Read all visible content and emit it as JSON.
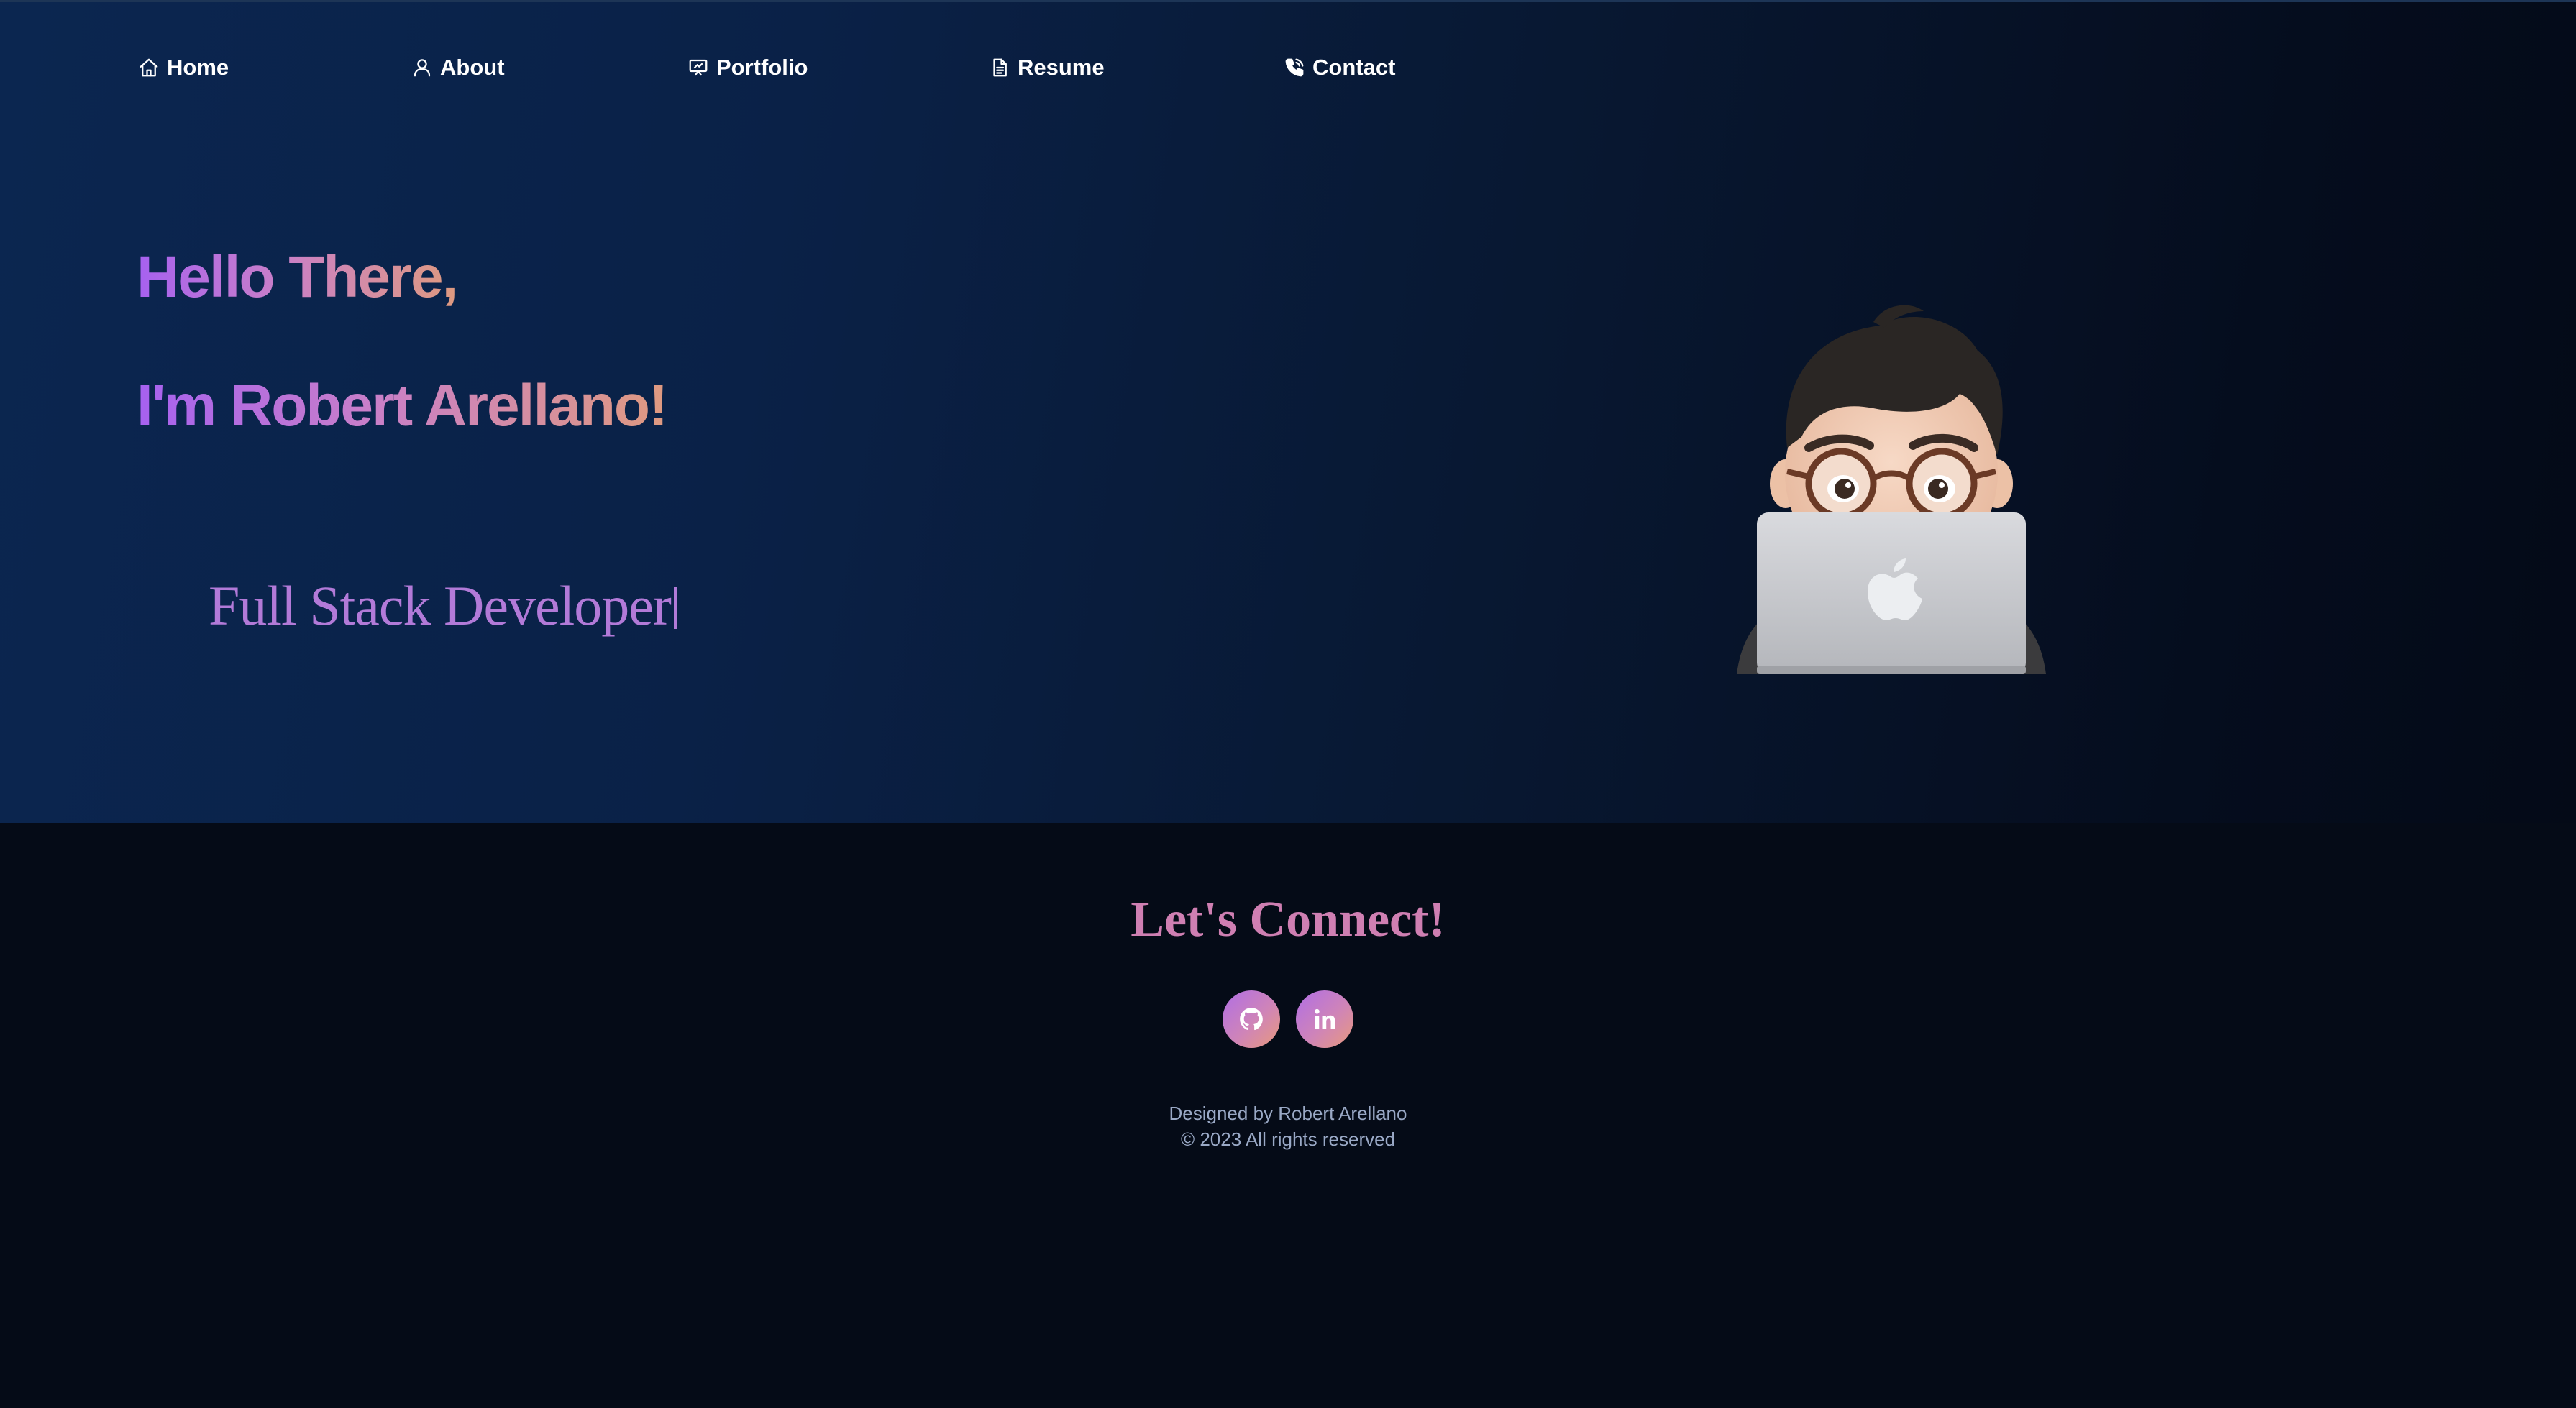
{
  "nav": {
    "items": [
      {
        "label": "Home",
        "icon": "home-icon"
      },
      {
        "label": "About",
        "icon": "user-icon"
      },
      {
        "label": "Portfolio",
        "icon": "presentation-icon"
      },
      {
        "label": "Resume",
        "icon": "document-icon"
      },
      {
        "label": "Contact",
        "icon": "phone-icon"
      }
    ]
  },
  "hero": {
    "greeting": "Hello There,",
    "name_line": "I'm Robert Arellano!",
    "role": "Full Stack Developer",
    "avatar": "memoji-laptop-avatar"
  },
  "footer": {
    "heading": "Let's Connect!",
    "socials": [
      {
        "name": "github",
        "icon": "github-icon"
      },
      {
        "name": "linkedin",
        "icon": "linkedin-icon"
      }
    ],
    "credit": "Designed by Robert Arellano",
    "copyright": "© 2023 All rights reserved"
  },
  "colors": {
    "accent_purple": "#a661f0",
    "accent_peach": "#df9a80",
    "hero_bg": "#0b2650",
    "footer_bg": "#050b17"
  }
}
